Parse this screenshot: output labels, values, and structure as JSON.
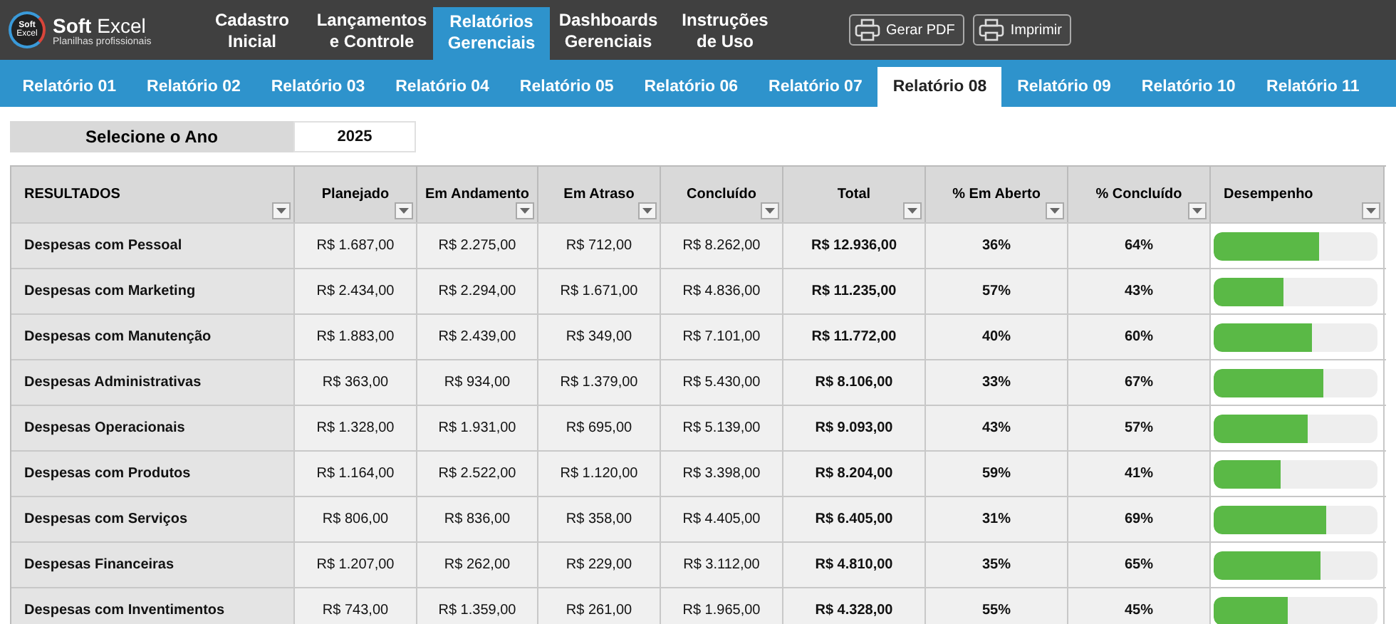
{
  "brand": {
    "name_bold": "Soft",
    "name_light": "Excel",
    "tagline": "Planilhas profissionais",
    "logo_text": [
      "Soft",
      "Excel"
    ]
  },
  "nav": [
    {
      "label": [
        "Cadastro",
        "Inicial"
      ],
      "selected": false
    },
    {
      "label": [
        "Lançamentos",
        "e Controle"
      ],
      "selected": false
    },
    {
      "label": [
        "Relatórios",
        "Gerenciais"
      ],
      "selected": true
    },
    {
      "label": [
        "Dashboards",
        "Gerenciais"
      ],
      "selected": false
    },
    {
      "label": [
        "Instruções",
        "de Uso"
      ],
      "selected": false
    }
  ],
  "actions": [
    "Gerar PDF",
    "Imprimir"
  ],
  "report_tabs": [
    {
      "label": "Relatório 01",
      "selected": false
    },
    {
      "label": "Relatório 02",
      "selected": false
    },
    {
      "label": "Relatório 03",
      "selected": false
    },
    {
      "label": "Relatório 04",
      "selected": false
    },
    {
      "label": "Relatório 05",
      "selected": false
    },
    {
      "label": "Relatório 06",
      "selected": false
    },
    {
      "label": "Relatório 07",
      "selected": false
    },
    {
      "label": "Relatório 08",
      "selected": true
    },
    {
      "label": "Relatório 09",
      "selected": false
    },
    {
      "label": "Relatório 10",
      "selected": false
    },
    {
      "label": "Relatório 11",
      "selected": false
    }
  ],
  "year": {
    "label": "Selecione o Ano",
    "value": "2025"
  },
  "table": {
    "columns": [
      "RESULTADOS",
      "Planejado",
      "Em Andamento",
      "Em Atraso",
      "Concluído",
      "Total",
      "% Em Aberto",
      "% Concluído",
      "Desempenho"
    ],
    "rows": [
      {
        "cells": [
          "Despesas com Pessoal",
          "R$ 1.687,00",
          "R$ 2.275,00",
          "R$ 712,00",
          "R$ 8.262,00",
          "R$ 12.936,00",
          "36%",
          "64%"
        ],
        "level": 0.64
      },
      {
        "cells": [
          "Despesas com Marketing",
          "R$ 2.434,00",
          "R$ 2.294,00",
          "R$ 1.671,00",
          "R$ 4.836,00",
          "R$ 11.235,00",
          "57%",
          "43%"
        ],
        "level": 0.43
      },
      {
        "cells": [
          "Despesas com Manutenção",
          "R$ 1.883,00",
          "R$ 2.439,00",
          "R$ 349,00",
          "R$ 7.101,00",
          "R$ 11.772,00",
          "40%",
          "60%"
        ],
        "level": 0.6
      },
      {
        "cells": [
          "Despesas Administrativas",
          "R$ 363,00",
          "R$ 934,00",
          "R$ 1.379,00",
          "R$ 5.430,00",
          "R$ 8.106,00",
          "33%",
          "67%"
        ],
        "level": 0.67
      },
      {
        "cells": [
          "Despesas Operacionais",
          "R$ 1.328,00",
          "R$ 1.931,00",
          "R$ 695,00",
          "R$ 5.139,00",
          "R$ 9.093,00",
          "43%",
          "57%"
        ],
        "level": 0.57
      },
      {
        "cells": [
          "Despesas com Produtos",
          "R$ 1.164,00",
          "R$ 2.522,00",
          "R$ 1.120,00",
          "R$ 3.398,00",
          "R$ 8.204,00",
          "59%",
          "41%"
        ],
        "level": 0.41
      },
      {
        "cells": [
          "Despesas com Serviços",
          "R$ 806,00",
          "R$ 836,00",
          "R$ 358,00",
          "R$ 4.405,00",
          "R$ 6.405,00",
          "31%",
          "69%"
        ],
        "level": 0.69
      },
      {
        "cells": [
          "Despesas Financeiras",
          "R$ 1.207,00",
          "R$ 262,00",
          "R$ 229,00",
          "R$ 3.112,00",
          "R$ 4.810,00",
          "35%",
          "65%"
        ],
        "level": 0.65
      },
      {
        "cells": [
          "Despesas com Inventimentos",
          "R$ 743,00",
          "R$ 1.359,00",
          "R$ 261,00",
          "R$ 1.965,00",
          "R$ 4.328,00",
          "55%",
          "45%"
        ],
        "level": 0.45
      }
    ]
  }
}
